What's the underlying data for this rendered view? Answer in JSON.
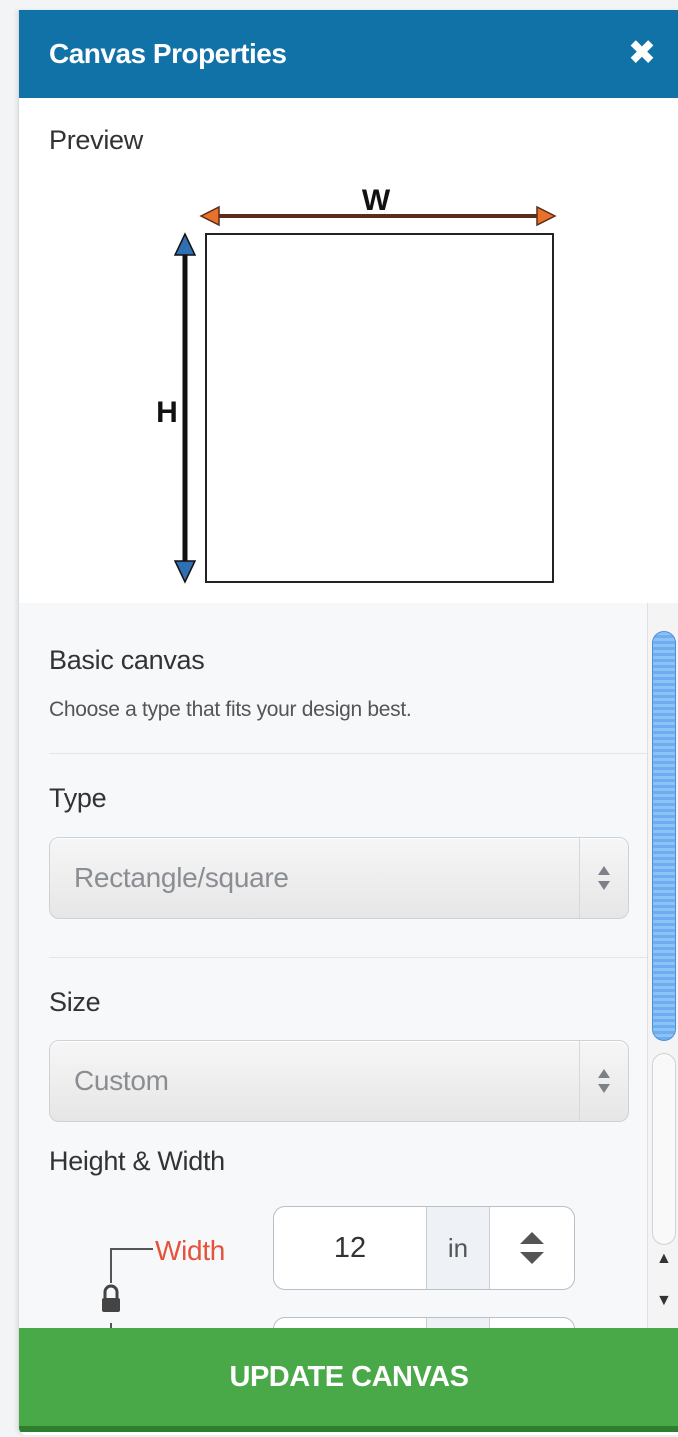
{
  "header": {
    "title": "Canvas Properties",
    "close_glyph": "✖"
  },
  "preview": {
    "label": "Preview",
    "width_label": "W",
    "height_label": "H"
  },
  "basic": {
    "title": "Basic canvas",
    "description": "Choose a type that fits your design best."
  },
  "type": {
    "label": "Type",
    "value": "Rectangle/square"
  },
  "size": {
    "label": "Size",
    "value": "Custom"
  },
  "dimensions": {
    "title": "Height & Width",
    "width_label": "Width",
    "width_value": "12",
    "unit": "in"
  },
  "footer": {
    "button_label": "UPDATE CANVAS"
  },
  "colors": {
    "header": "#1172a8",
    "button": "#49a847",
    "width_label": "#e5533c"
  },
  "icons": [
    "close-icon",
    "lock-icon",
    "select-arrows-icon",
    "stepper-icon",
    "scroll-up-icon",
    "scroll-down-icon"
  ]
}
